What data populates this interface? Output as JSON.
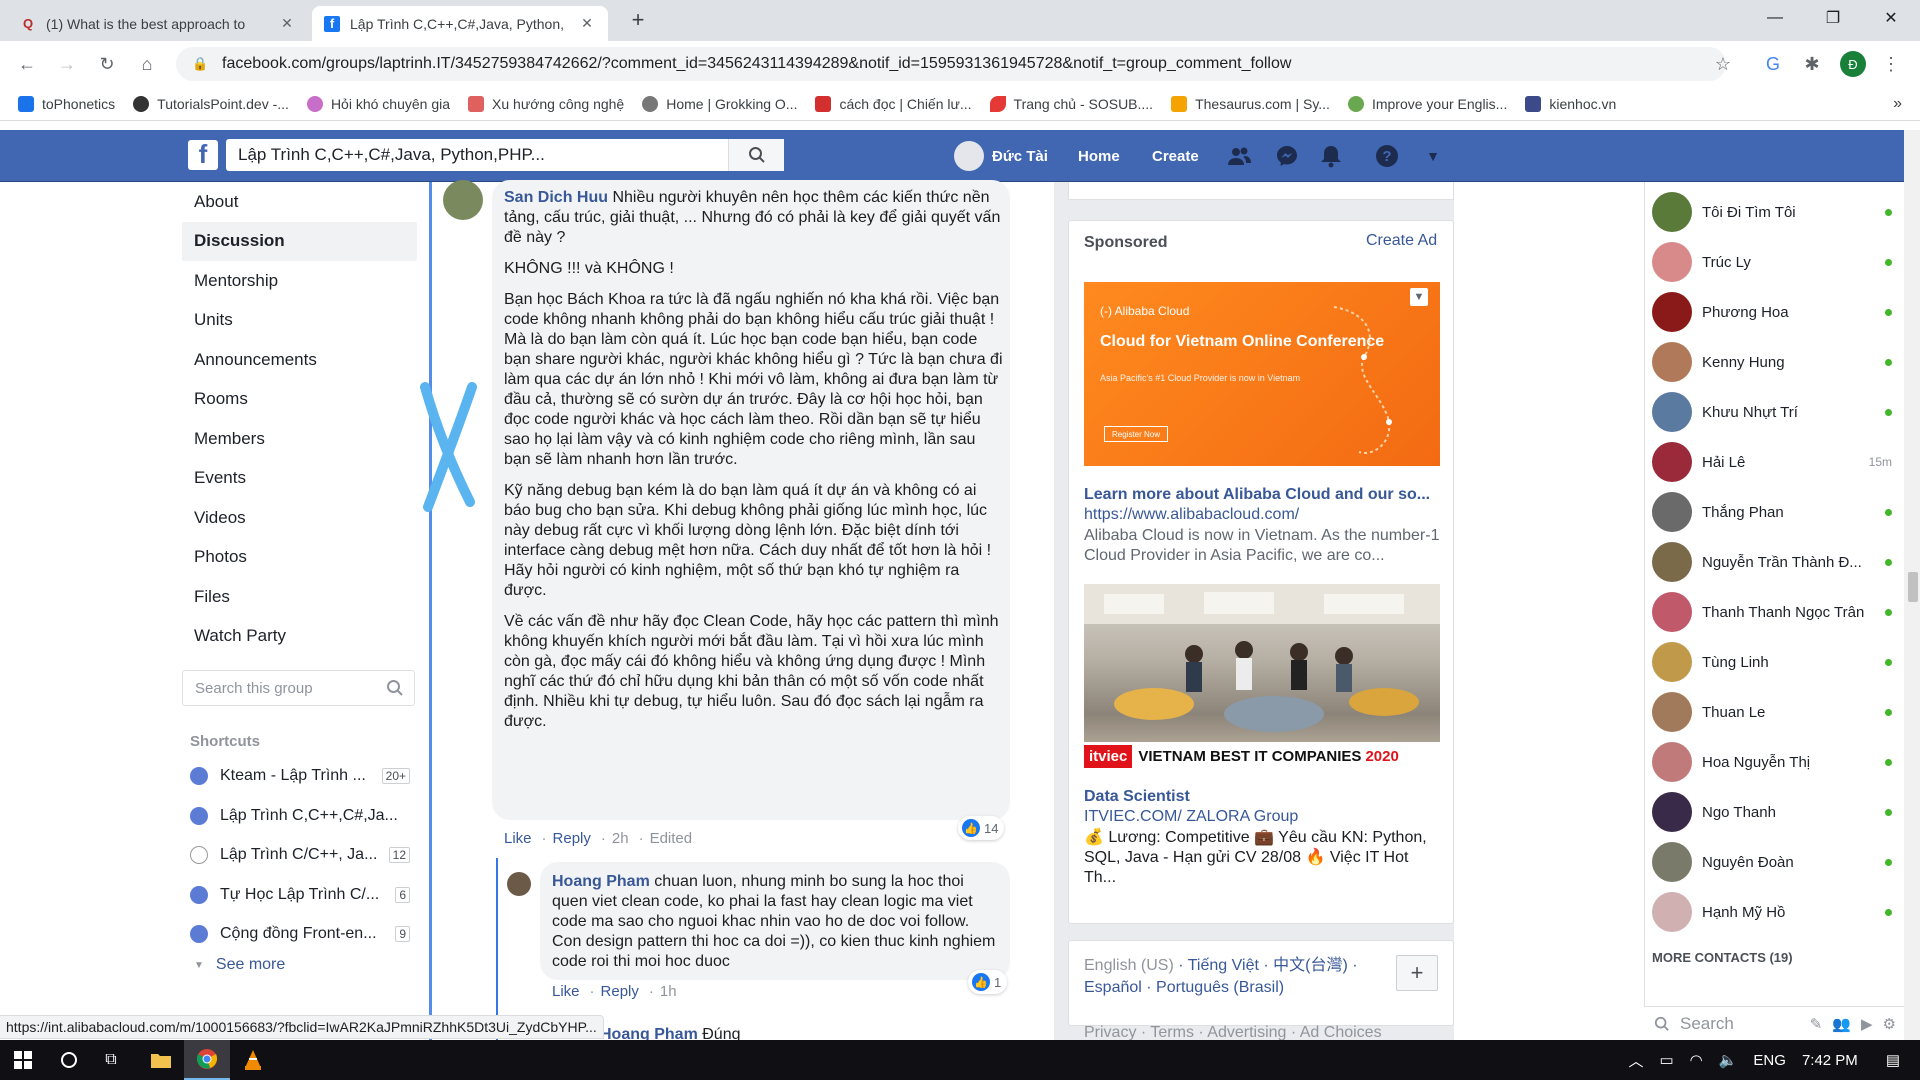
{
  "browser": {
    "tabs": [
      {
        "title": "(1) What is the best approach to",
        "favicon": "Q",
        "active": false
      },
      {
        "title": "Lập Trình C,C++,C#,Java, Python,",
        "favicon": "f",
        "active": true
      }
    ],
    "new_tab": "+",
    "url": "facebook.com/groups/laptrinh.IT/3452759384742662/?comment_id=3456243114394289&notif_id=1595931361945728&notif_t=group_comment_follow",
    "profile_initial": "Đ",
    "bookmarks": [
      "toPhonetics",
      "TutorialsPoint.dev -...",
      "Hỏi khó chuyên gia",
      "Xu hướng công nghệ",
      "Home | Grokking O...",
      "cách đọc | Chiến lư...",
      "Trang chủ - SOSUB....",
      "Thesaurus.com | Sy...",
      "Improve your Englis...",
      "kienhoc.vn"
    ],
    "bookmark_overflow": "»",
    "status_url": "https://int.alibabacloud.com/m/1000156683/?fbclid=IwAR2KaJPmniRZhhK5Dt3Ui_ZydCbYHP..."
  },
  "fb_header": {
    "logo": "f",
    "search_value": "Lập Trình C,C++,C#,Java, Python,PHP...",
    "user_name": "Đức Tài",
    "home": "Home",
    "create": "Create"
  },
  "left_nav": {
    "items": [
      "About",
      "Discussion",
      "Mentorship",
      "Units",
      "Announcements",
      "Rooms",
      "Members",
      "Events",
      "Videos",
      "Photos",
      "Files",
      "Watch Party"
    ],
    "selected": "Discussion",
    "search_placeholder": "Search this group",
    "shortcuts_title": "Shortcuts",
    "shortcuts": [
      {
        "name": "Kteam - Lập Trình ...",
        "count": "20+"
      },
      {
        "name": "Lập Trình C,C++,C#,Ja...",
        "count": ""
      },
      {
        "name": "Lập Trình C/C++, Ja...",
        "count": "12"
      },
      {
        "name": "Tự Học Lập Trình C/...",
        "count": "6"
      },
      {
        "name": "Cộng đồng Front-en...",
        "count": "9"
      }
    ],
    "see_more": "See more"
  },
  "comment": {
    "author": "San Dich Huu",
    "paragraphs": [
      "Nhiều người khuyên nên học thêm các kiến thức nền tảng, cấu trúc, giải thuật, ... Nhưng đó có phải là key để giải quyết vấn đề này ?",
      "KHÔNG !!! và KHÔNG !",
      "Bạn học Bách Khoa ra tức là đã ngấu nghiến nó kha khá rồi. Việc bạn code không nhanh không phải do bạn không hiểu cấu trúc giải thuật ! Mà là do bạn làm còn quá ít. Lúc học bạn code bạn hiểu, bạn code bạn share người khác, người khác không hiểu gì ? Tức là bạn chưa đi làm qua các dự án lớn nhỏ ! Khi mới vô làm, không ai đưa bạn làm từ đầu cả, thường sẽ có sườn dự án trước. Đây là cơ hội học hỏi, bạn đọc code người khác và học cách làm theo. Rồi dần bạn sẽ tự hiểu sao họ lại làm vậy và có kinh nghiệm code cho riêng mình, lần sau bạn sẽ làm nhanh hơn lần trước.",
      "Kỹ năng debug bạn kém là do bạn làm quá ít dự án và không có ai báo bug cho bạn sửa. Khi debug không phải giống lúc mình học, lúc này debug rất cực vì khối lượng dòng lệnh lớn. Đặc biệt dính tới interface càng debug mệt hơn nữa. Cách duy nhất để tốt hơn là hỏi ! Hãy hỏi người có kinh nghiệm, một số thứ bạn khó tự nghiệm ra được.",
      "Về các vấn đề như hãy đọc Clean Code, hãy học các pattern thì mình không khuyến khích người mới bắt đầu làm. Tại vì hồi xưa lúc mình còn gà, đọc mấy cái đó không hiểu và không ứng dụng được ! Mình nghĩ các thứ đó chỉ hữu dụng khi bản thân có một số vốn code nhất định. Nhiều khi tự debug, tự hiểu luôn. Sau đó đọc sách lại ngẫm ra được."
    ],
    "like_count": "14",
    "like": "Like",
    "reply": "Reply",
    "time": "2h",
    "edited": "Edited"
  },
  "reply": {
    "author": "Hoang Pham",
    "text": "chuan luon, nhung minh bo sung la hoc thoi quen viet clean code, ko phai la fast hay clean logic ma viet code ma sao cho nguoi khac nhin vao ho de doc voi follow. Con design pattern thi hoc ca doi =)), co kien thuc kinh nghiem code roi thi moi hoc duoc",
    "like_count": "1",
    "like": "Like",
    "reply": "Reply",
    "time": "1h",
    "next_author": "Hoang Pham",
    "next_text": "Đúng"
  },
  "ads": {
    "sponsored": "Sponsored",
    "create_ad": "Create Ad",
    "ad1": {
      "img_brand": "(-) Alibaba Cloud",
      "img_headline": "Cloud for Vietnam Online Conference",
      "img_sub": "Asia Pacific's #1 Cloud Provider is now in Vietnam",
      "img_button": "Register Now",
      "title": "Learn more about Alibaba Cloud and our so...",
      "url": "https://www.alibabacloud.com/",
      "body": "Alibaba Cloud is now in Vietnam. As the number-1 Cloud Provider in Asia Pacific, we are co..."
    },
    "ad2": {
      "img_logo": "itviec",
      "img_caption": "VIETNAM BEST IT COMPANIES",
      "img_year": "2020",
      "title": "Data Scientist",
      "url": "ITVIEC.COM/ ZALORA Group",
      "body": "💰 Lương: Competitive 💼 Yêu cầu KN: Python, SQL, Java - Hạn gửi CV 28/08 🔥 Việc IT Hot Th..."
    },
    "languages": {
      "current": "English (US)",
      "others": [
        "Tiếng Việt",
        "中文(台灣)",
        "Español",
        "Português (Brasil)"
      ]
    },
    "footer": "Privacy · Terms · Advertising · Ad Choices"
  },
  "chat": {
    "contacts": [
      {
        "name": "Tôi Đi Tìm Tôi",
        "status": "online",
        "color": "#5a7a3a"
      },
      {
        "name": "Trúc Ly",
        "status": "online",
        "color": "#d88a8a"
      },
      {
        "name": "Phương Hoa",
        "status": "online",
        "color": "#8a1a1a"
      },
      {
        "name": "Kenny Hung",
        "status": "online",
        "color": "#b07a5a"
      },
      {
        "name": "Khưu Nhựt Trí",
        "status": "online",
        "color": "#5a7aa0"
      },
      {
        "name": "Hải Lê",
        "status": "15m",
        "color": "#9a2a3a"
      },
      {
        "name": "Thắng Phan",
        "status": "online",
        "color": "#6a6a6a"
      },
      {
        "name": "Nguyễn Trần Thành Đ...",
        "status": "online",
        "color": "#7a6a4a"
      },
      {
        "name": "Thanh Thanh Ngọc Trân",
        "status": "online",
        "color": "#c05a6a"
      },
      {
        "name": "Tùng Linh",
        "status": "online",
        "color": "#c09a4a"
      },
      {
        "name": "Thuan Le",
        "status": "online",
        "color": "#a07a5a"
      },
      {
        "name": "Hoa Nguyễn Thị",
        "status": "online",
        "color": "#c07a7a"
      },
      {
        "name": "Ngo Thanh",
        "status": "online",
        "color": "#3a2a4a"
      },
      {
        "name": "Nguyên Đoàn",
        "status": "online",
        "color": "#7a7a6a"
      },
      {
        "name": "Hạnh Mỹ Hồ",
        "status": "online",
        "color": "#d0b0b0"
      }
    ],
    "more_contacts": "MORE CONTACTS (19)",
    "search_placeholder": "Search"
  },
  "taskbar": {
    "lang": "ENG",
    "time": "7:42 PM"
  }
}
